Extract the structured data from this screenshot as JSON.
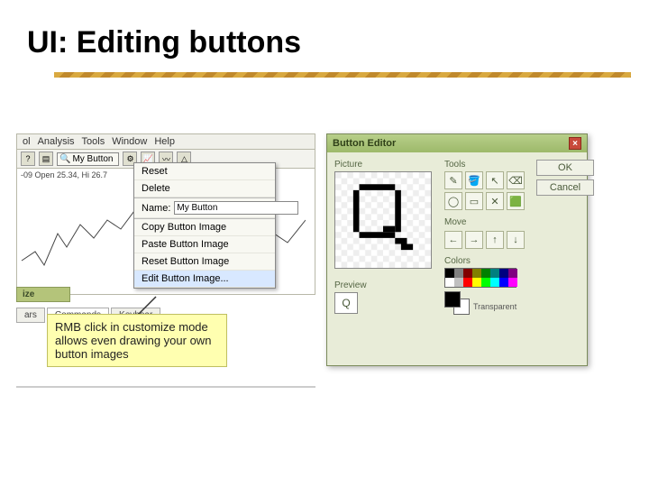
{
  "slide": {
    "title": "UI: Editing buttons"
  },
  "app": {
    "menu": [
      "ol",
      "Analysis",
      "Tools",
      "Window",
      "Help"
    ],
    "my_button_label": "My Button",
    "chart_info": "-09 Open 25.34, Hi 26.7"
  },
  "context_menu": {
    "reset": "Reset",
    "delete": "Delete",
    "name_label": "Name:",
    "name_value": "My Button",
    "copy_image": "Copy Button Image",
    "paste_image": "Paste Button Image",
    "reset_image": "Reset Button Image",
    "edit_image": "Edit Button Image..."
  },
  "customize": {
    "title": "ize",
    "tabs": [
      "ars",
      "Commands",
      "Keyboar"
    ]
  },
  "note": {
    "text": "RMB click in customize mode allows even drawing your own button images"
  },
  "editor": {
    "title": "Button Editor",
    "picture_label": "Picture",
    "tools_label": "Tools",
    "move_label": "Move",
    "preview_label": "Preview",
    "colors_label": "Colors",
    "transparent_label": "Transparent",
    "ok": "OK",
    "cancel": "Cancel",
    "preview_glyph": "Q",
    "colors": [
      "#000000",
      "#808080",
      "#800000",
      "#808000",
      "#008000",
      "#008080",
      "#000080",
      "#800080",
      "#ffffff",
      "#c0c0c0",
      "#ff0000",
      "#ffff00",
      "#00ff00",
      "#00ffff",
      "#0000ff",
      "#ff00ff"
    ],
    "tool_icons": [
      "✎",
      "🪣",
      "↖",
      "⌫",
      "◯",
      "▭",
      "✕",
      "🟩"
    ],
    "move_icons": [
      "←",
      "→",
      "↑",
      "↓"
    ]
  }
}
